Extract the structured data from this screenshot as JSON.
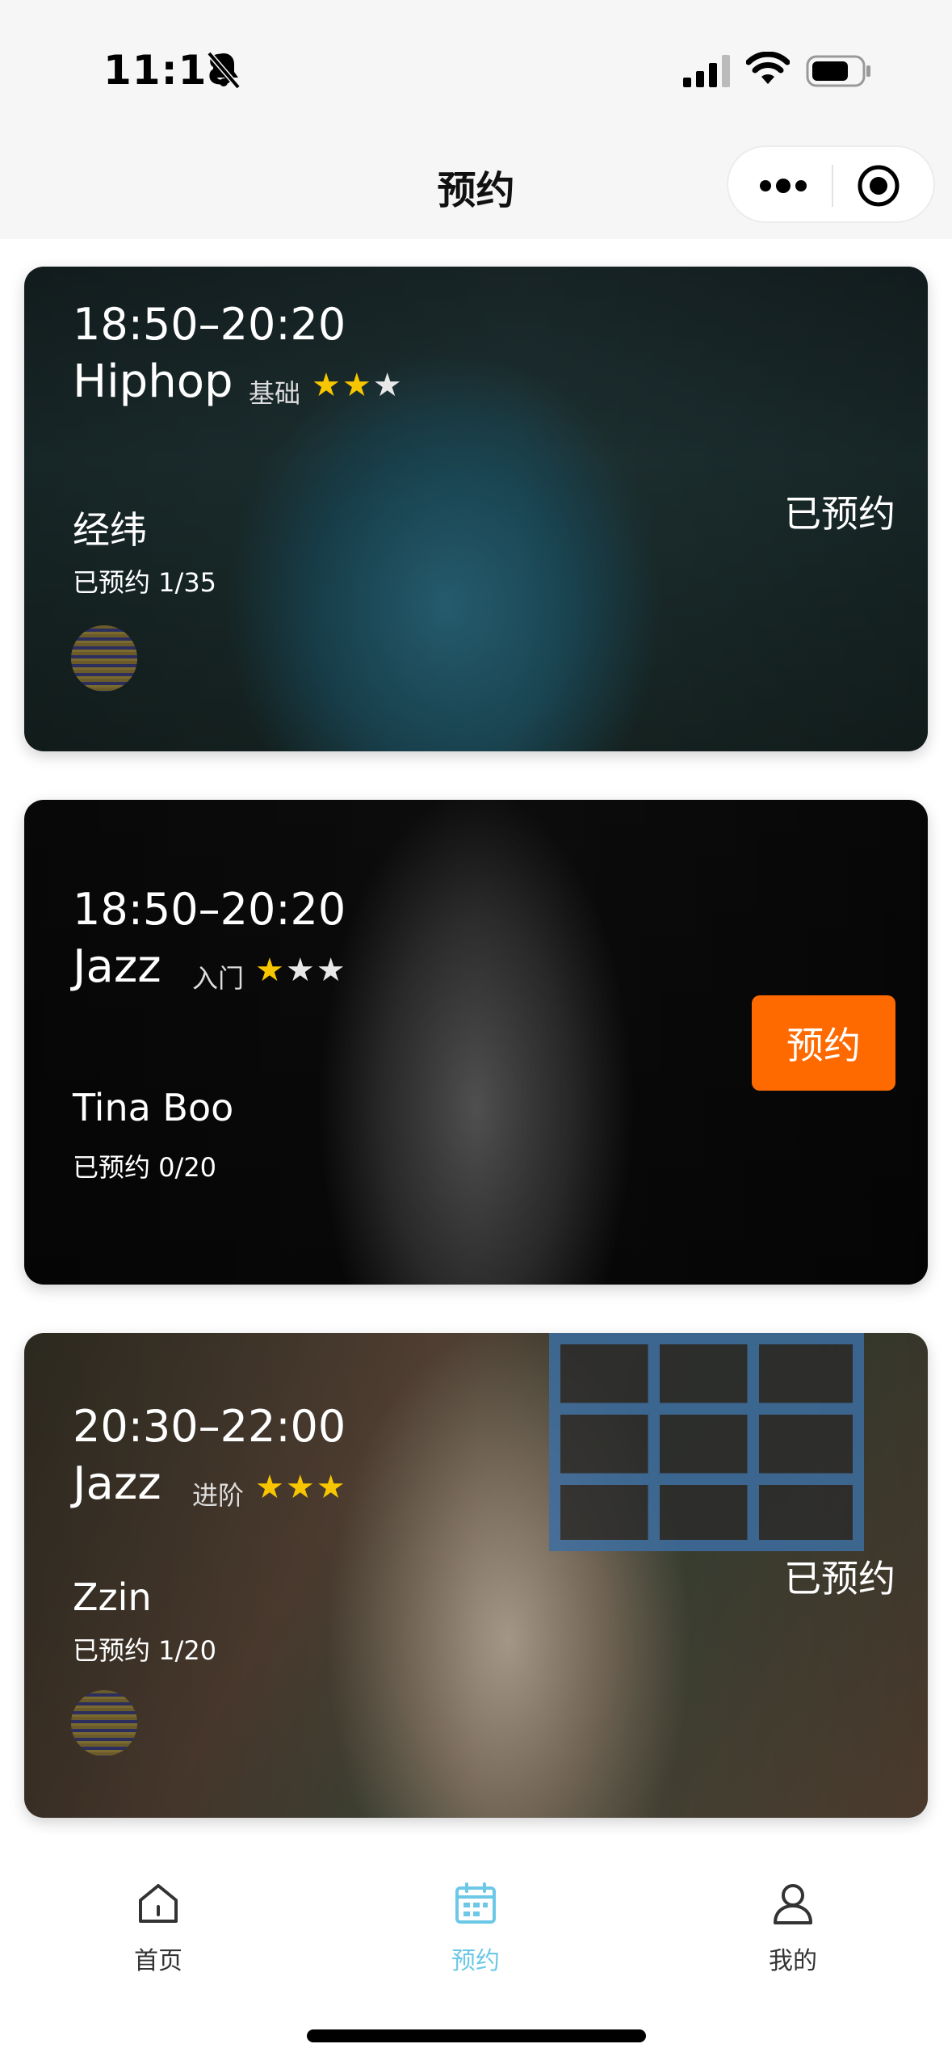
{
  "status_bar": {
    "time": "11:18",
    "icons": [
      "bell-off-icon",
      "signal-icon",
      "wifi-icon",
      "battery-icon"
    ]
  },
  "nav": {
    "title": "预约",
    "capsule_icons": [
      "more-dots-icon",
      "target-icon"
    ]
  },
  "classes": [
    {
      "time": "18:50–20:20",
      "style": "Hiphop",
      "level": "基础",
      "stars_filled": 2,
      "stars_total": 3,
      "teacher": "经纬",
      "booked_count": "已预约 1/35",
      "status": "已预约"
    },
    {
      "time": "18:50–20:20",
      "style": "Jazz",
      "level": "入门",
      "stars_filled": 1,
      "stars_total": 3,
      "teacher": "Tina Boo",
      "booked_count": "已预约 0/20",
      "action_label": "预约"
    },
    {
      "time": "20:30–22:00",
      "style": "Jazz",
      "level": "进阶",
      "stars_filled": 3,
      "stars_total": 3,
      "teacher": "Zzin",
      "booked_count": "已预约 1/20",
      "status": "已预约"
    }
  ],
  "tabbar": {
    "items": [
      {
        "label": "首页",
        "icon": "home-icon",
        "active": false
      },
      {
        "label": "预约",
        "icon": "calendar-icon",
        "active": true
      },
      {
        "label": "我的",
        "icon": "user-icon",
        "active": false
      }
    ]
  },
  "colors": {
    "accent_orange": "#ff6a00",
    "tab_active": "#6cc8e6",
    "star_gold": "#f7c600"
  }
}
